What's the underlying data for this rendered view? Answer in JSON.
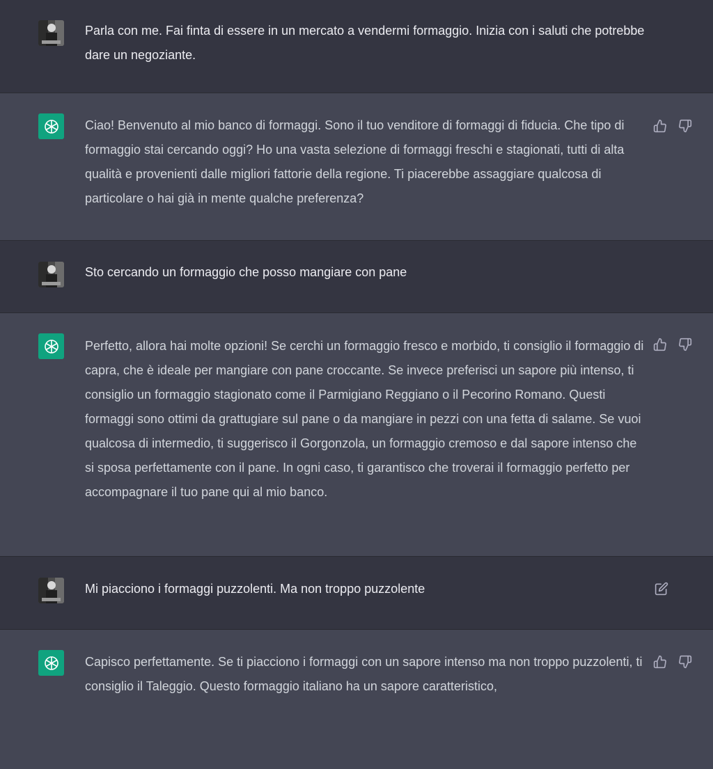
{
  "messages": [
    {
      "role": "user",
      "text": "Parla con me. Fai finta di essere in un mercato a vendermi formaggio. Inizia con i saluti che potrebbe dare un negoziante."
    },
    {
      "role": "assistant",
      "text": "Ciao! Benvenuto al mio banco di formaggi. Sono il tuo venditore di formaggi di fiducia. Che tipo di formaggio stai cercando oggi? Ho una vasta selezione di formaggi freschi e stagionati, tutti di alta qualità e provenienti dalle migliori fattorie della regione. Ti piacerebbe assaggiare qualcosa di particolare o hai già in mente qualche preferenza?"
    },
    {
      "role": "user",
      "text": "Sto cercando un formaggio che posso mangiare con pane"
    },
    {
      "role": "assistant",
      "text": "Perfetto, allora hai molte opzioni! Se cerchi un formaggio fresco e morbido, ti consiglio il formaggio di capra, che è ideale per mangiare con pane croccante. Se invece preferisci un sapore più intenso, ti consiglio un formaggio stagionato come il Parmigiano Reggiano o il Pecorino Romano. Questi formaggi sono ottimi da grattugiare sul pane o da mangiare in pezzi con una fetta di salame. Se vuoi qualcosa di intermedio, ti suggerisco il Gorgonzola, un formaggio cremoso e dal sapore intenso che si sposa perfettamente con il pane. In ogni caso, ti garantisco che troverai il formaggio perfetto per accompagnare il tuo pane qui al mio banco."
    },
    {
      "role": "user",
      "text": "Mi piacciono i formaggi puzzolenti. Ma non troppo puzzolente"
    },
    {
      "role": "assistant",
      "text": "Capisco perfettamente. Se ti piacciono i formaggi con un sapore intenso ma non troppo puzzolenti, ti consiglio il Taleggio. Questo formaggio italiano ha un sapore caratteristico,"
    }
  ],
  "icons": {
    "user_avatar": "user-avatar-photo",
    "assistant_avatar": "openai-logo-icon",
    "like": "thumbs-up-icon",
    "dislike": "thumbs-down-icon",
    "edit": "edit-icon"
  },
  "colors": {
    "user_bg": "#343541",
    "assistant_bg": "#444654",
    "accent": "#10a37f"
  }
}
